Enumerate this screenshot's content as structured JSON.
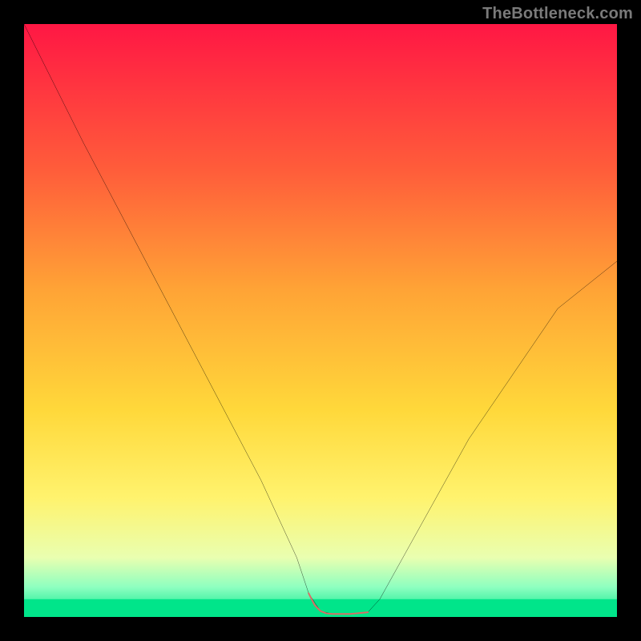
{
  "watermark": "TheBottleneck.com",
  "chart_data": {
    "type": "line",
    "title": "",
    "xlabel": "",
    "ylabel": "",
    "xlim": [
      0,
      100
    ],
    "ylim": [
      0,
      100
    ],
    "grid": false,
    "series": [
      {
        "name": "curve",
        "color": "#000000",
        "x": [
          0,
          10,
          20,
          30,
          40,
          46,
          48,
          50,
          52,
          55,
          58,
          60,
          65,
          75,
          90,
          100
        ],
        "y": [
          100,
          80,
          61,
          42,
          23,
          10,
          4,
          1,
          0.5,
          0.5,
          0.8,
          3,
          12,
          30,
          52,
          60
        ]
      },
      {
        "name": "bottom-highlight",
        "color": "#d86e66",
        "x": [
          48,
          49,
          50,
          51,
          52,
          53,
          54,
          55,
          56,
          57,
          58
        ],
        "y": [
          4,
          2,
          1,
          0.6,
          0.5,
          0.5,
          0.5,
          0.5,
          0.6,
          0.7,
          0.8
        ]
      }
    ],
    "background_gradient": {
      "stops": [
        {
          "offset": 0.0,
          "color": "#ff1744"
        },
        {
          "offset": 0.25,
          "color": "#ff5e3a"
        },
        {
          "offset": 0.45,
          "color": "#ffa436"
        },
        {
          "offset": 0.65,
          "color": "#ffd83a"
        },
        {
          "offset": 0.8,
          "color": "#fff36e"
        },
        {
          "offset": 0.9,
          "color": "#e9ffb0"
        },
        {
          "offset": 0.95,
          "color": "#8dffc0"
        },
        {
          "offset": 1.0,
          "color": "#00e58a"
        }
      ]
    },
    "bottom_band": {
      "color1": "#8dffc0",
      "color2": "#00e58a",
      "height_frac": 0.03
    }
  }
}
